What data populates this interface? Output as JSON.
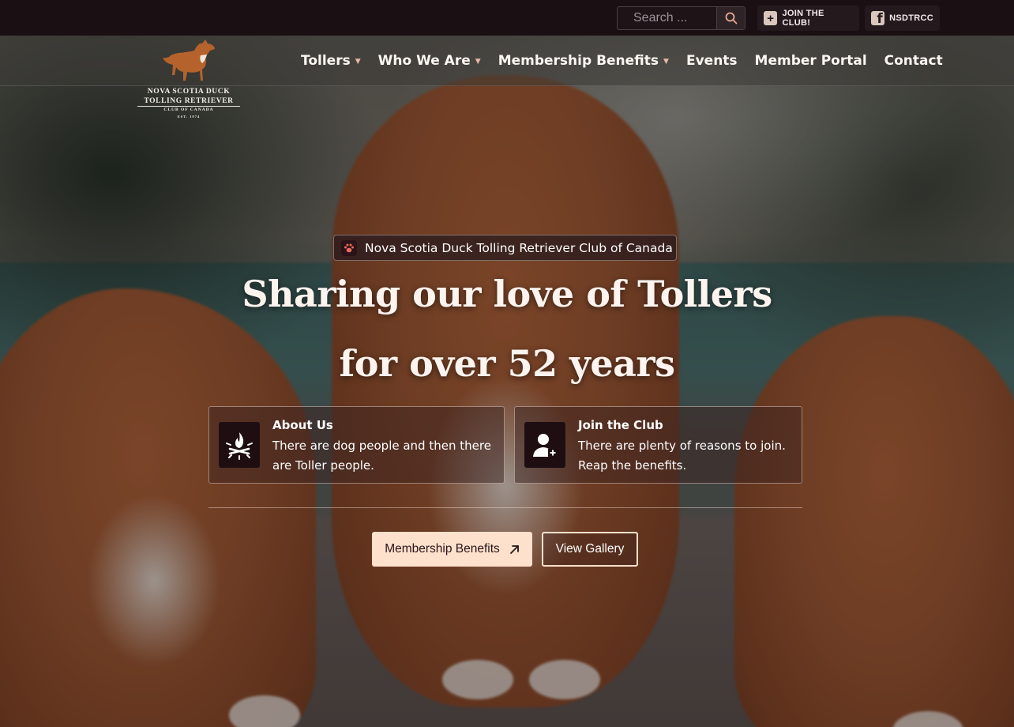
{
  "topbar": {
    "search": {
      "placeholder": "Search ...",
      "value": ""
    },
    "join_label": "JOIN THE CLUB!",
    "facebook_label": "NSDTRCC"
  },
  "logo": {
    "line1": "NOVA SCOTIA DUCK",
    "line2": "TOLLING RETRIEVER",
    "line3": "CLUB OF CANADA",
    "line4": "EST. 1974"
  },
  "nav": {
    "items": [
      {
        "label": "Tollers",
        "has_dropdown": true
      },
      {
        "label": "Who We Are",
        "has_dropdown": true
      },
      {
        "label": "Membership Benefits",
        "has_dropdown": true
      },
      {
        "label": "Events",
        "has_dropdown": false
      },
      {
        "label": "Member Portal",
        "has_dropdown": false
      },
      {
        "label": "Contact",
        "has_dropdown": false
      }
    ]
  },
  "hero": {
    "tagline": "Nova Scotia Duck Tolling Retriever Club of Canada",
    "headline_line1": "Sharing our love of Tollers",
    "headline_line2": "for over 52 years",
    "cards": [
      {
        "title": "About Us",
        "description": "There are dog people and then there are Toller people.",
        "icon": "campfire-icon"
      },
      {
        "title": "Join the Club",
        "description": "There are plenty of reasons to join. Reap the benefits.",
        "icon": "add-user-icon"
      }
    ],
    "primary_button": "Membership Benefits",
    "secondary_button": "View Gallery"
  },
  "colors": {
    "topbar_bg": "#1a0f13",
    "accent": "#fde1cd",
    "icon_bg": "#1e0e12",
    "chevron": "#e8b8a4"
  }
}
